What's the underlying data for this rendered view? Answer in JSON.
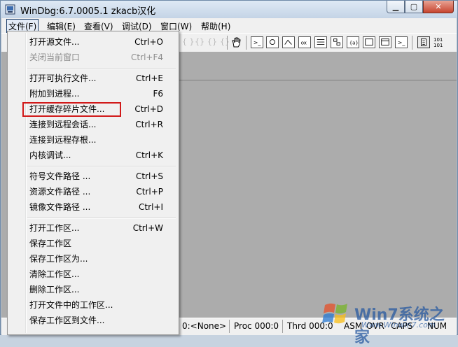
{
  "window": {
    "title": "WinDbg:6.7.0005.1 zkacb汉化"
  },
  "menubar": {
    "items": [
      {
        "label": "文件(F)"
      },
      {
        "label": "编辑(E)"
      },
      {
        "label": "查看(V)"
      },
      {
        "label": "调试(D)"
      },
      {
        "label": "窗口(W)"
      },
      {
        "label": "帮助(H)"
      }
    ]
  },
  "file_menu": {
    "items": [
      {
        "label": "打开源文件...",
        "shortcut": "Ctrl+O",
        "enabled": true
      },
      {
        "label": "关闭当前窗口",
        "shortcut": "Ctrl+F4",
        "enabled": false
      },
      {
        "label": "打开可执行文件...",
        "shortcut": "Ctrl+E",
        "enabled": true
      },
      {
        "label": "附加到进程...",
        "shortcut": "F6",
        "enabled": true
      },
      {
        "label": "打开缓存碎片文件...",
        "shortcut": "Ctrl+D",
        "enabled": true
      },
      {
        "label": "连接到远程会话...",
        "shortcut": "Ctrl+R",
        "enabled": true
      },
      {
        "label": "连接到远程存根...",
        "shortcut": "",
        "enabled": true
      },
      {
        "label": "内核调试...",
        "shortcut": "Ctrl+K",
        "enabled": true
      },
      {
        "label": "符号文件路径 ...",
        "shortcut": "Ctrl+S",
        "enabled": true
      },
      {
        "label": "资源文件路径 ...",
        "shortcut": "Ctrl+P",
        "enabled": true
      },
      {
        "label": "镜像文件路径 ...",
        "shortcut": "Ctrl+I",
        "enabled": true
      },
      {
        "label": "打开工作区...",
        "shortcut": "Ctrl+W",
        "enabled": true
      },
      {
        "label": "保存工作区",
        "shortcut": "",
        "enabled": true
      },
      {
        "label": "保存工作区为...",
        "shortcut": "",
        "enabled": true
      },
      {
        "label": "清除工作区...",
        "shortcut": "",
        "enabled": true
      },
      {
        "label": "删除工作区...",
        "shortcut": "",
        "enabled": true
      },
      {
        "label": "打开文件中的工作区...",
        "shortcut": "",
        "enabled": true
      },
      {
        "label": "保存工作区到文件...",
        "shortcut": "",
        "enabled": true
      }
    ]
  },
  "statusbar": {
    "thread_label": "0:<None>",
    "proc_label": "Proc 000:0",
    "thrd_label": "Thrd 000:0",
    "asm": "ASM",
    "ovr": "OVR",
    "caps": "CAPS",
    "num": "NUM"
  },
  "watermark": {
    "brand": "Win7系统之家",
    "url": "Www.Winwin7.com"
  },
  "colors": {
    "highlight_box": "#d11a1a",
    "client_bg": "#acacac"
  }
}
